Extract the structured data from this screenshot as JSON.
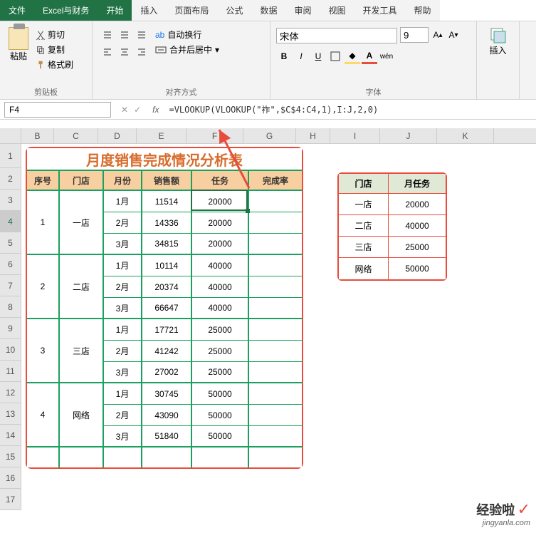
{
  "tabs": {
    "file": "文件",
    "custom": "Excel与财务",
    "home": "开始",
    "insert": "插入",
    "layout": "页面布局",
    "formulas": "公式",
    "data": "数据",
    "review": "审阅",
    "view": "视图",
    "dev": "开发工具",
    "help": "帮助"
  },
  "ribbon": {
    "clipboard": {
      "paste": "粘贴",
      "cut": "剪切",
      "copy": "复制",
      "brush": "格式刷",
      "label": "剪贴板"
    },
    "align": {
      "wrap": "自动换行",
      "merge": "合并后居中",
      "label": "对齐方式"
    },
    "font": {
      "name": "宋体",
      "size": "9",
      "label": "字体"
    },
    "insert": {
      "label": "插入"
    }
  },
  "cellRef": "F4",
  "formula": "=VLOOKUP(VLOOKUP(\"祚\",$C$4:C4,1),I:J,2,0)",
  "cols": [
    "B",
    "C",
    "D",
    "E",
    "F",
    "G",
    "H",
    "I",
    "J",
    "K"
  ],
  "rows": [
    "1",
    "2",
    "3",
    "4",
    "5",
    "6",
    "7",
    "8",
    "9",
    "10",
    "11",
    "12",
    "13",
    "14",
    "15",
    "16",
    "17"
  ],
  "title": "月度销售完成情况分析表",
  "headers": {
    "b": "序号",
    "c": "门店",
    "d": "月份",
    "e": "销售额",
    "f": "任务",
    "g": "完成率"
  },
  "data": [
    {
      "no": "1",
      "store": "一店",
      "rows": [
        {
          "m": "1月",
          "sales": "11514",
          "task": "20000"
        },
        {
          "m": "2月",
          "sales": "14336",
          "task": "20000"
        },
        {
          "m": "3月",
          "sales": "34815",
          "task": "20000"
        }
      ]
    },
    {
      "no": "2",
      "store": "二店",
      "rows": [
        {
          "m": "1月",
          "sales": "10114",
          "task": "40000"
        },
        {
          "m": "2月",
          "sales": "20374",
          "task": "40000"
        },
        {
          "m": "3月",
          "sales": "66647",
          "task": "40000"
        }
      ]
    },
    {
      "no": "3",
      "store": "三店",
      "rows": [
        {
          "m": "1月",
          "sales": "17721",
          "task": "25000"
        },
        {
          "m": "2月",
          "sales": "41242",
          "task": "25000"
        },
        {
          "m": "3月",
          "sales": "27002",
          "task": "25000"
        }
      ]
    },
    {
      "no": "4",
      "store": "网络",
      "rows": [
        {
          "m": "1月",
          "sales": "30745",
          "task": "50000"
        },
        {
          "m": "2月",
          "sales": "43090",
          "task": "50000"
        },
        {
          "m": "3月",
          "sales": "51840",
          "task": "50000"
        }
      ]
    }
  ],
  "side": {
    "h1": "门店",
    "h2": "月任务",
    "rows": [
      {
        "s": "一店",
        "v": "20000"
      },
      {
        "s": "二店",
        "v": "40000"
      },
      {
        "s": "三店",
        "v": "25000"
      },
      {
        "s": "网络",
        "v": "50000"
      }
    ]
  },
  "watermark": {
    "main": "经验啦",
    "sub": "jingyanla.com"
  }
}
